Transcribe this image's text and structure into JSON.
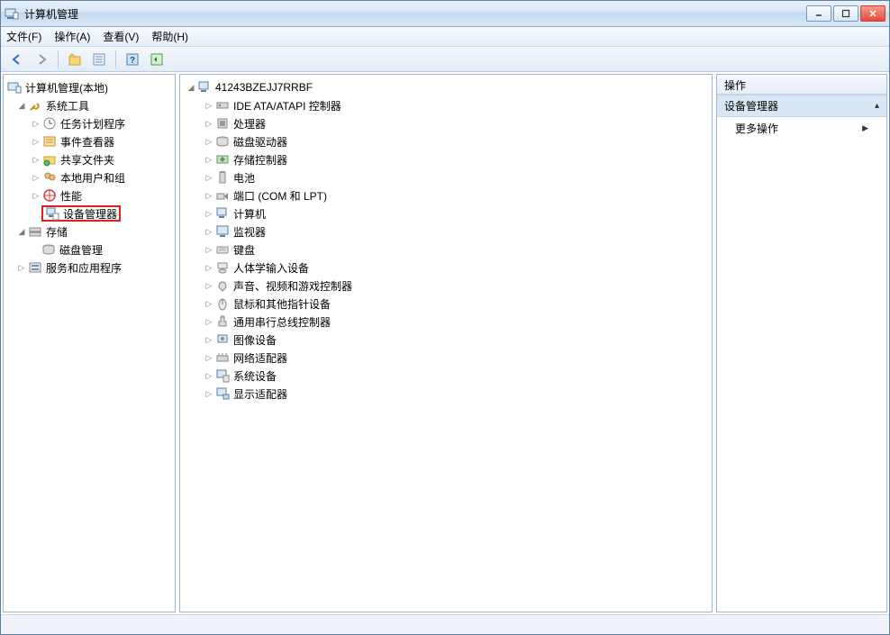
{
  "title": "计算机管理",
  "menus": {
    "file": "文件(F)",
    "action": "操作(A)",
    "view": "查看(V)",
    "help": "帮助(H)"
  },
  "left_tree": {
    "root": "计算机管理(本地)",
    "system_tools": "系统工具",
    "task_scheduler": "任务计划程序",
    "event_viewer": "事件查看器",
    "shared_folders": "共享文件夹",
    "local_users": "本地用户和组",
    "performance": "性能",
    "device_manager": "设备管理器",
    "storage": "存储",
    "disk_mgmt": "磁盘管理",
    "services_apps": "服务和应用程序"
  },
  "center_tree": {
    "computer": "41243BZEJJ7RRBF",
    "items": [
      "IDE ATA/ATAPI 控制器",
      "处理器",
      "磁盘驱动器",
      "存储控制器",
      "电池",
      "端口 (COM 和 LPT)",
      "计算机",
      "监视器",
      "键盘",
      "人体学输入设备",
      "声音、视频和游戏控制器",
      "鼠标和其他指针设备",
      "通用串行总线控制器",
      "图像设备",
      "网络适配器",
      "系统设备",
      "显示适配器"
    ]
  },
  "right_panel": {
    "header": "操作",
    "selected": "设备管理器",
    "more": "更多操作"
  }
}
